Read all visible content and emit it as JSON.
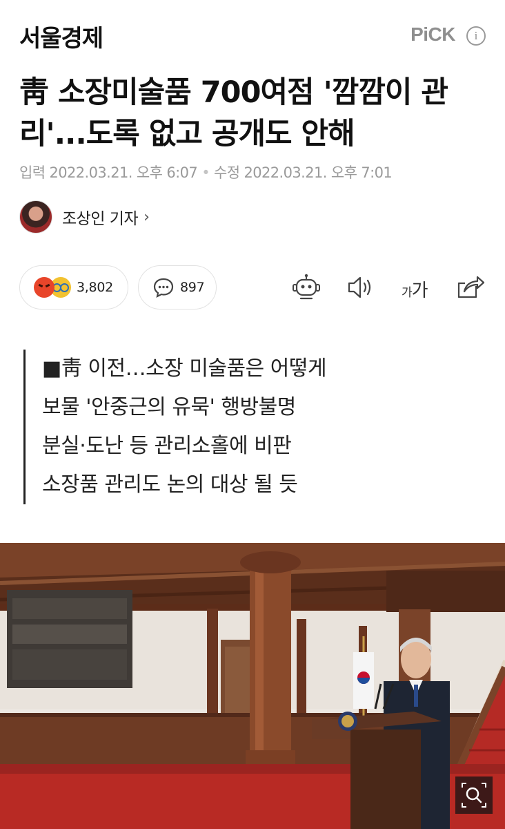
{
  "header": {
    "brand": "서울경제",
    "pick_label": "PiCK",
    "info_label": "i"
  },
  "article": {
    "title": "靑 소장미술품 700여점 '깜깜이 관리'...도록 없고 공개도 안해",
    "input_date": "입력 2022.03.21. 오후 6:07",
    "separator": "•",
    "edit_date": "수정 2022.03.21. 오후 7:01",
    "author": "조상인 기자",
    "author_chevron": "›",
    "summary": [
      "■靑 이전…소장 미술품은 어떻게",
      "보물 '안중근의 유묵' 행방불명",
      "분실·도난 등 관리소홀에 비판",
      "소장품 관리도 논의 대상 될 듯"
    ]
  },
  "actions": {
    "reaction_count": "3,802",
    "comment_count": "897",
    "font_size_small": "가",
    "font_size_large": "가"
  },
  "icons": {
    "reaction_1": "angry-emoji-icon",
    "reaction_2": "nerd-emoji-icon",
    "comment": "comment-bubble-icon",
    "tts_bot": "robot-icon",
    "audio": "speaker-icon",
    "share": "share-icon",
    "zoom": "magnifier-icon"
  },
  "colors": {
    "brand_text": "#111111",
    "muted": "#9a9a9a",
    "angry": "#e8452a",
    "nerd": "#f2c230",
    "carpet": "#b82a24"
  }
}
